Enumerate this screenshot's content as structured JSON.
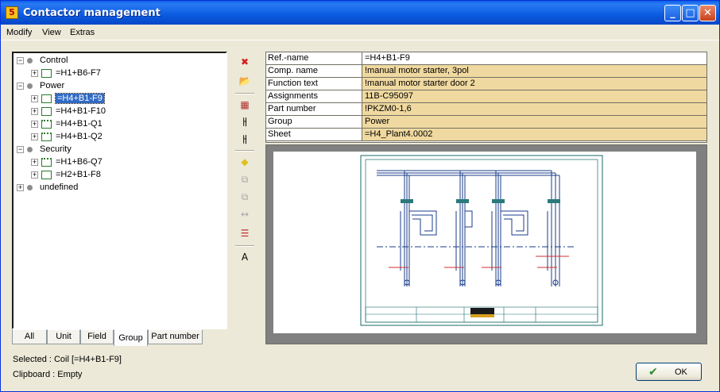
{
  "window": {
    "title": "Contactor management",
    "app_icon_letter": "5"
  },
  "menu": [
    "Modify",
    "View",
    "Extras"
  ],
  "tree": [
    {
      "label": "Control",
      "type": "group",
      "level": 0
    },
    {
      "label": "=H1+B6-F7",
      "type": "item",
      "level": 1,
      "dotted": false
    },
    {
      "label": "Power",
      "type": "group",
      "level": 0
    },
    {
      "label": "=H4+B1-F9",
      "type": "item",
      "level": 1,
      "dotted": false,
      "selected": true
    },
    {
      "label": "=H4+B1-F10",
      "type": "item",
      "level": 1,
      "dotted": false
    },
    {
      "label": "=H4+B1-Q1",
      "type": "item",
      "level": 1,
      "dotted": true
    },
    {
      "label": "=H4+B1-Q2",
      "type": "item",
      "level": 1,
      "dotted": true
    },
    {
      "label": "Security",
      "type": "group",
      "level": 0
    },
    {
      "label": "=H1+B6-Q7",
      "type": "item",
      "level": 1,
      "dotted": true
    },
    {
      "label": "=H2+B1-F8",
      "type": "item",
      "level": 1,
      "dotted": false
    },
    {
      "label": "undefined",
      "type": "group",
      "level": 0
    }
  ],
  "tabs": [
    {
      "label": "All",
      "active": false
    },
    {
      "label": "Unit",
      "active": false
    },
    {
      "label": "Field",
      "active": false
    },
    {
      "label": "Group",
      "active": true
    },
    {
      "label": "Part number",
      "active": false
    }
  ],
  "status": {
    "selected": "Selected : Coil [=H4+B1-F9]",
    "clipboard": "Clipboard : Empty"
  },
  "properties": [
    {
      "key": "Ref.-name",
      "value": "=H4+B1-F9"
    },
    {
      "key": "Comp. name",
      "value": "!manual motor starter, 3pol"
    },
    {
      "key": "Function text",
      "value": "!manual motor starter door 2"
    },
    {
      "key": "Assignments",
      "value": "11B-C95097"
    },
    {
      "key": "Part number",
      "value": "!PKZM0-1,6"
    },
    {
      "key": "Group",
      "value": "Power"
    },
    {
      "key": "Sheet",
      "value": "=H4_Plant4.0002"
    }
  ],
  "toolbar": [
    {
      "name": "delete-icon",
      "glyph": "✖",
      "color": "#d02020",
      "disabled": false
    },
    {
      "name": "open-folder-icon",
      "glyph": "📂",
      "color": "#c89a20",
      "disabled": false
    },
    {
      "name": "table-icon",
      "glyph": "▦",
      "color": "#b03030",
      "disabled": false
    },
    {
      "name": "contact-icon",
      "glyph": "ㅐ",
      "color": "#000000",
      "disabled": false
    },
    {
      "name": "contact-remove-icon",
      "glyph": "ㅐ",
      "color": "#000000",
      "disabled": false
    },
    {
      "name": "eraser-icon",
      "glyph": "◆",
      "color": "#e0c020",
      "disabled": false
    },
    {
      "name": "copy-icon",
      "glyph": "⧉",
      "color": "#a8a8a8",
      "disabled": true
    },
    {
      "name": "paste-icon",
      "glyph": "⧉",
      "color": "#a8a8a8",
      "disabled": true
    },
    {
      "name": "swap-icon",
      "glyph": "↔",
      "color": "#a8a8a8",
      "disabled": true
    },
    {
      "name": "settings-icon",
      "glyph": "☰",
      "color": "#c03030",
      "disabled": false
    },
    {
      "name": "text-size-icon",
      "glyph": "A",
      "color": "#000000",
      "disabled": false
    }
  ],
  "ok_button": {
    "label": "OK"
  },
  "colors": {
    "accent": "#316ac5",
    "property_value_bg": "#f0d9a0",
    "schematic_line": "#1a3c8a",
    "schematic_red": "#d03030"
  }
}
